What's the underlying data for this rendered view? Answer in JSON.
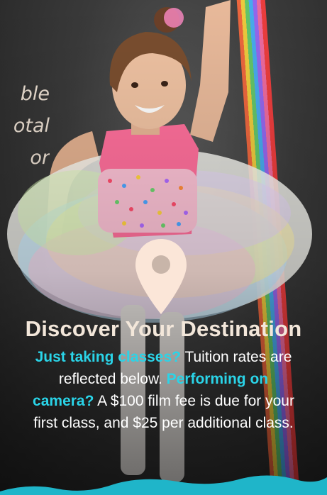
{
  "left_text": {
    "line1": "ble",
    "line2": "otal",
    "line3": "or"
  },
  "heading": "Discover Your Destination",
  "body": {
    "highlight1": "Just taking classes?",
    "text1": " Tuition rates are",
    "text2": "reflected below. ",
    "highlight2": "Performing on",
    "highlight3": "camera?",
    "text3": " A $100 film fee is due for your",
    "text4": "first class, and $25 per additional class."
  },
  "colors": {
    "accent": "#2ad4e8",
    "heading": "#f3e7da",
    "pin": "#fbe6d8",
    "wave": "#1fb5c9"
  },
  "icons": {
    "pin": "location-pin-icon"
  }
}
